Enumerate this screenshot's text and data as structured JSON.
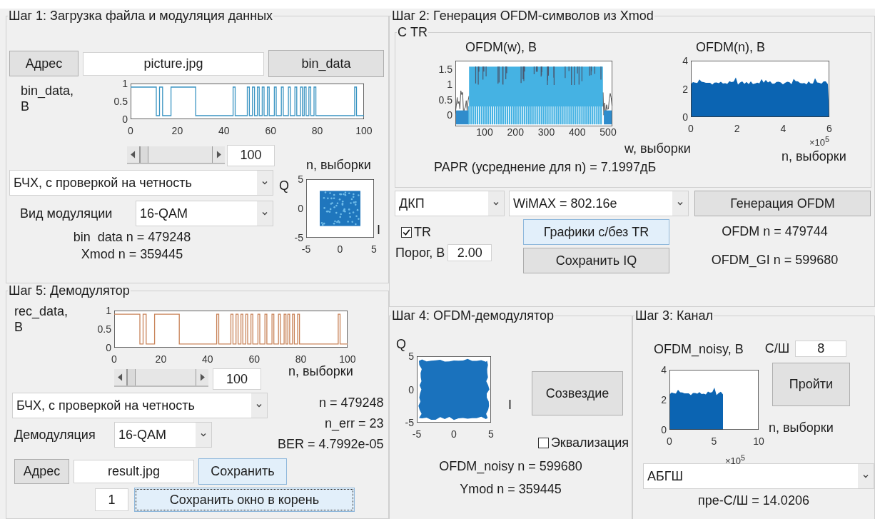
{
  "step1": {
    "title": "Шаг 1: Загрузка файла и модуляция данных",
    "address_button": {
      "label": "Адрес",
      "highlighted": false,
      "focused": false
    },
    "file_field": {
      "value": "picture.jpg"
    },
    "bin_data_button": {
      "label": "bin_data",
      "highlighted": false,
      "focused": false
    },
    "plot": {
      "kind": "binary",
      "ylabel": "bin_data,\nB",
      "yticks": [
        "1",
        "0.5",
        "0"
      ],
      "xticks": [
        "0",
        "20",
        "40",
        "60",
        "80",
        "100"
      ],
      "xlabel": "n, выборки"
    },
    "slider": {
      "level": 0
    },
    "window_field": {
      "value": "100"
    },
    "coding_dropdown": {
      "value": "БЧХ, с проверкой на четность"
    },
    "modulation_label": "Вид модуляции",
    "modulation_dropdown": {
      "value": "16-QAM"
    },
    "info": [
      "bin  data n = 479248",
      "Xmod n = 359445"
    ],
    "constellation": {
      "kind": "constellation",
      "ylabel": "Q",
      "yticks": [
        "5",
        "0",
        "-5"
      ],
      "xticks": [
        "-5",
        "0",
        "5"
      ],
      "xlabel": "I"
    }
  },
  "step5": {
    "title": "Шаг 5: Демодулятор",
    "plot": {
      "kind": "binary",
      "ylabel": "rec_data,\nB",
      "yticks": [
        "1",
        "0.5",
        "0"
      ],
      "xticks": [
        "0",
        "20",
        "40",
        "60",
        "80",
        "100"
      ],
      "xlabel": "n, выборки"
    },
    "slider": {
      "level": 0
    },
    "window_field": {
      "value": "100"
    },
    "coding_dropdown": {
      "value": "БЧХ, с проверкой на четность"
    },
    "demod_label": "Демодуляция",
    "demod_dropdown": {
      "value": "16-QAM"
    },
    "stats": [
      "n = 479248",
      "n_err = 23",
      "BER = 4.7992e-05"
    ],
    "address_button": {
      "label": "Адрес",
      "highlighted": false,
      "focused": false
    },
    "file_field": {
      "value": "result.jpg"
    },
    "save_button": {
      "label": "Сохранить",
      "highlighted": true,
      "focused": false
    },
    "index_field": {
      "value": "1"
    },
    "save_window_button": {
      "label": "Сохранить окно в корень",
      "highlighted": true,
      "focused": true
    }
  },
  "step2": {
    "title": "Шаг 2: Генерация OFDM-символов из Xmod",
    "tr_panel": {
      "title": "С TR",
      "spectrum": {
        "kind": "spectrum",
        "title": "OFDM(w), B",
        "yticks": [
          "1.5",
          "1",
          "0.5",
          "0"
        ],
        "xticks": [
          "100",
          "200",
          "300",
          "400",
          "500"
        ],
        "xlabel": "w, выборки"
      },
      "papr": "PAPR (усреднение для n)  = 7.1997дБ",
      "signal": {
        "kind": "envelope",
        "title": "OFDM(n), B",
        "yticks": [
          "4",
          "2",
          "0"
        ],
        "xticks": [
          "0",
          "2",
          "4",
          "6"
        ],
        "exponent": "×10$^{5}$",
        "xlabel": "n, выборки"
      }
    },
    "transform_dropdown": {
      "value": "ДКП"
    },
    "standard_dropdown": {
      "value": "WiMAX = 802.16e"
    },
    "generate_button": {
      "label": "Генерация OFDM",
      "highlighted": false,
      "focused": false
    },
    "tr_checkbox": {
      "label": "TR",
      "checked": true
    },
    "threshold_label": "Порог, В",
    "threshold_field": {
      "value": "2.00"
    },
    "plots_button": {
      "label": "Графики с/без TR",
      "highlighted": true,
      "focused": false
    },
    "save_iq_button": {
      "label": "Сохранить IQ",
      "highlighted": false,
      "focused": false
    },
    "info": [
      "OFDM n = 479744",
      "OFDM_GI n = 599680"
    ]
  },
  "step4": {
    "title": "Шаг 4: OFDM-демодулятор",
    "constellation": {
      "kind": "cloud",
      "ylabel": "Q",
      "yticks": [
        "5",
        "0",
        "-5"
      ],
      "xticks": [
        "-5",
        "0",
        "5"
      ],
      "xlabel": "I"
    },
    "constellation_button": {
      "label": "Созвездие",
      "highlighted": false,
      "focused": false
    },
    "equalization_checkbox": {
      "label": "Эквализация",
      "checked": false
    },
    "info": [
      "OFDM_noisy n = 599680",
      "Ymod n = 359445"
    ]
  },
  "step3": {
    "title": "Шаг 3: Канал",
    "plot": {
      "kind": "burst",
      "title": "OFDM_noisy, B",
      "yticks": [
        "4",
        "2",
        "0"
      ],
      "xticks": [
        "0",
        "5",
        "10"
      ],
      "exponent": "×10$^{5}$",
      "xlabel": "n, выборки"
    },
    "snr_label": "С/Ш",
    "snr_field": {
      "value": "8"
    },
    "run_button": {
      "label": "Пройти",
      "highlighted": false,
      "focused": false
    },
    "channel_dropdown": {
      "value": "АБГШ"
    },
    "result": "пре-С/Ш = 14.0206"
  }
}
